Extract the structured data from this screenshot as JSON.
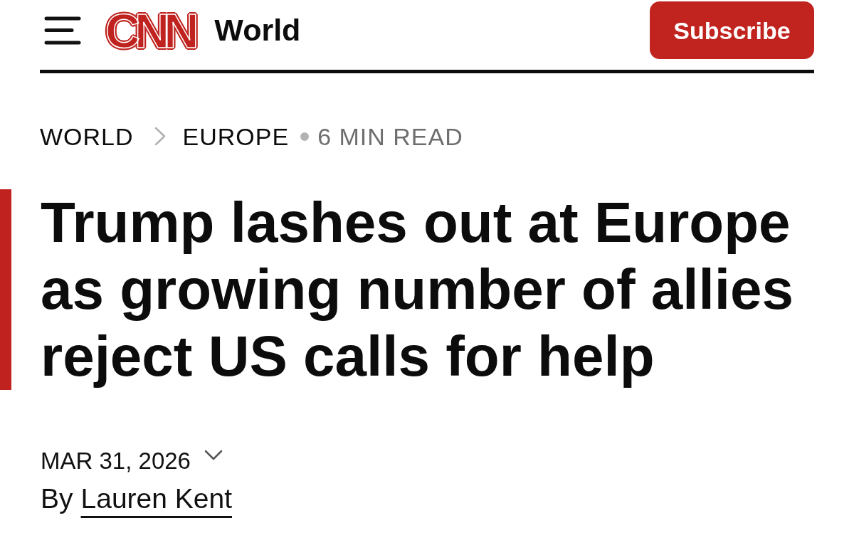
{
  "header": {
    "logo": "CNN",
    "section": "World",
    "subscribe": "Subscribe"
  },
  "breadcrumb": [
    {
      "label": "WORLD"
    },
    {
      "label": "EUROPE"
    }
  ],
  "read_time": "6 MIN READ",
  "headline": "Trump lashes out at Europe as growing number of allies reject US calls for help",
  "date": {
    "text": "MAR 31, 2026",
    "expanded": false
  },
  "byline": {
    "prefix": "By",
    "author": "Lauren Kent"
  }
}
